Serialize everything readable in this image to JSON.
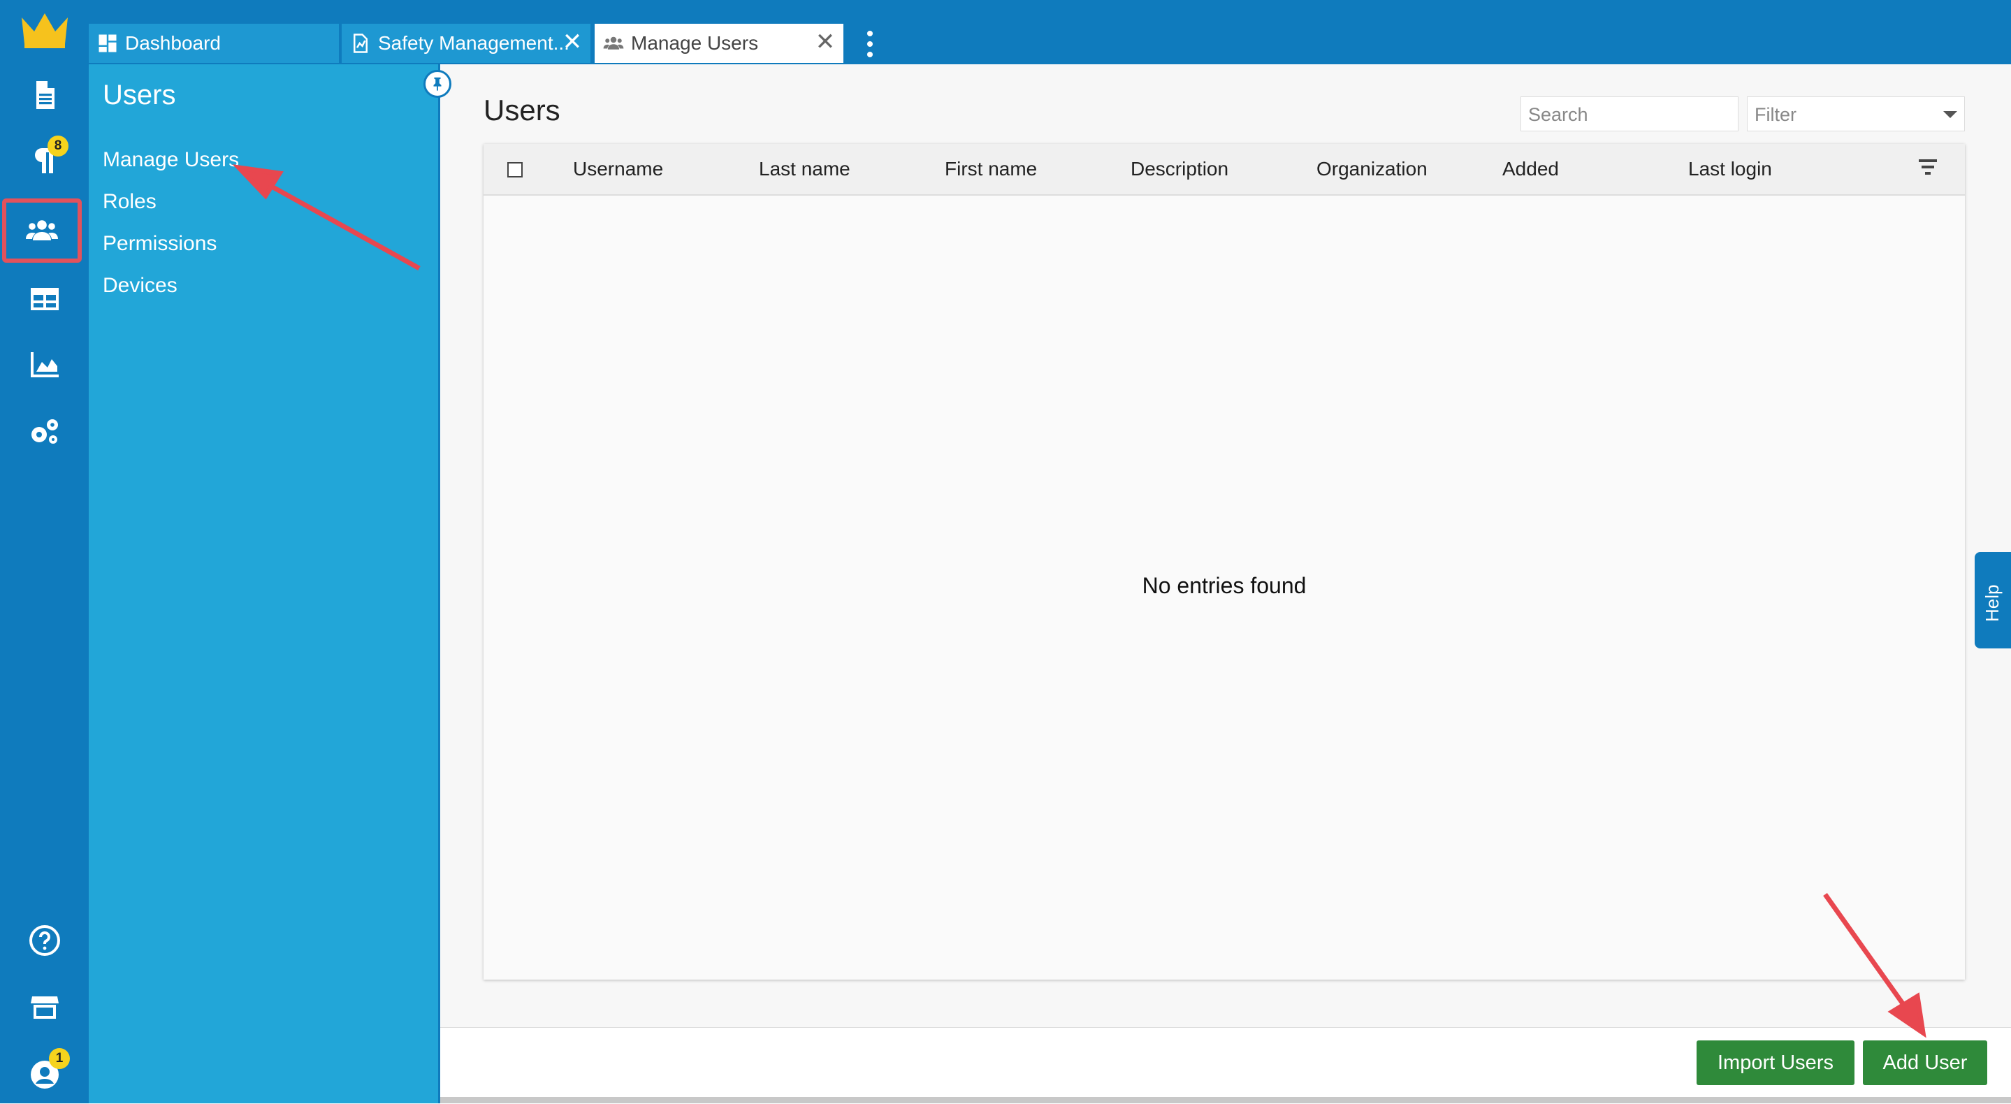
{
  "rail": {
    "items": [
      {
        "icon": "crown-logo-icon"
      },
      {
        "icon": "document-icon"
      },
      {
        "icon": "paragraph-icon",
        "badge": "8"
      },
      {
        "icon": "users-icon"
      },
      {
        "icon": "table-icon"
      },
      {
        "icon": "area-chart-icon"
      },
      {
        "icon": "gears-icon"
      },
      {
        "icon": "help-circle-icon"
      },
      {
        "icon": "store-icon"
      },
      {
        "icon": "user-account-icon",
        "badge": "1"
      }
    ]
  },
  "tabs": [
    {
      "label": "Dashboard",
      "icon": "dashboard-icon"
    },
    {
      "label": "Safety Management...",
      "icon": "document-chart-icon",
      "close": "✕"
    },
    {
      "label": "Manage Users",
      "icon": "users-icon",
      "close": "✕"
    }
  ],
  "panel": {
    "title": "Users",
    "items": [
      "Manage Users",
      "Roles",
      "Permissions",
      "Devices"
    ]
  },
  "main": {
    "title": "Users",
    "search_placeholder": "Search",
    "filter_placeholder": "Filter",
    "columns": [
      "Username",
      "Last name",
      "First name",
      "Description",
      "Organization",
      "Added",
      "Last login"
    ],
    "empty_text": "No entries found"
  },
  "help_label": "Help",
  "buttons": {
    "import": "Import Users",
    "add": "Add User"
  },
  "colors": {
    "rail": "#0f7bbd",
    "panel": "#22a6d8",
    "button": "#2f8a3a",
    "badge": "#f6d31d",
    "annotation": "#e8474f"
  }
}
